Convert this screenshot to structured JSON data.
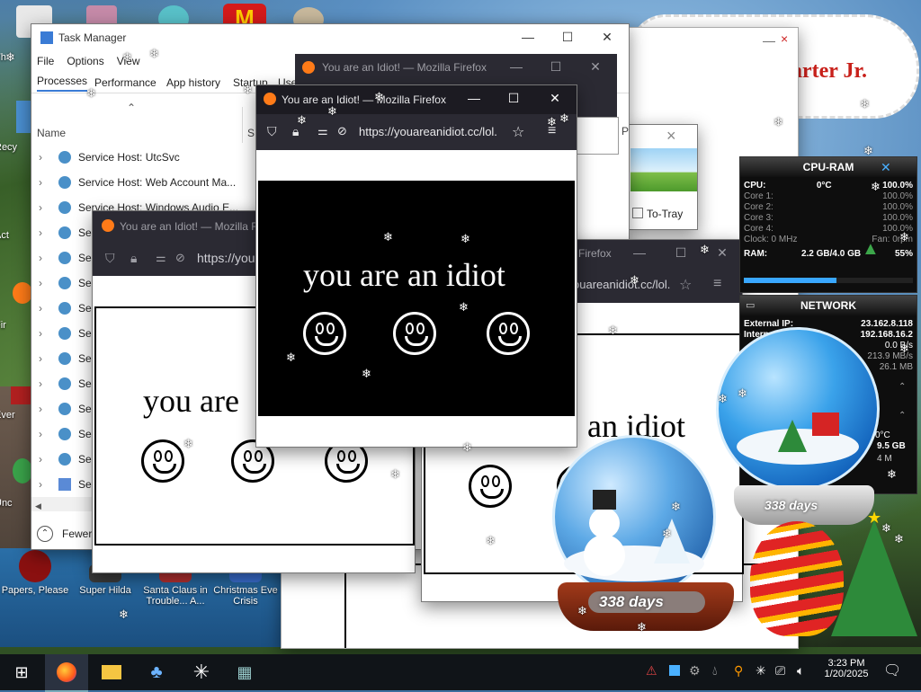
{
  "desktop": {
    "billboard_text": "arter Jr.",
    "icons": [
      {
        "label": "Papers, Please"
      },
      {
        "label": "Super Hilda"
      },
      {
        "label": "Santa Claus in Trouble... A..."
      },
      {
        "label": "Christmas Eve Crisis"
      }
    ],
    "edge_labels": [
      "Th",
      "Recy",
      "Act",
      "Fir",
      "Ever",
      "Unc"
    ]
  },
  "task_manager": {
    "title": "Task Manager",
    "menu": [
      "File",
      "Options",
      "View"
    ],
    "tabs": [
      "Processes",
      "Performance",
      "App history",
      "Startup",
      "Use"
    ],
    "col_name": "Name",
    "col_status": "S",
    "rows": [
      "Service Host: UtcSvc",
      "Service Host: Web Account Ma...",
      "Service Host: Windows Audio E...",
      "Serv",
      "Serv",
      "Serv",
      "Serv",
      "Serv",
      "Serv",
      "Serv",
      "Serv",
      "Serv",
      "Serv",
      "Serv"
    ],
    "fewer_details": "Fewer"
  },
  "windows": {
    "title": "You are an Idiot! — Mozilla Firefox",
    "url_main": "https://youareanidiot.cc/lol.",
    "url_small": "https://you",
    "url_right": "ouareanidiot.cc/lol.",
    "partial_title_right": "Firefox",
    "phrase": "you are an idiot",
    "phrase_left": "you are",
    "phrase_right": "an idiot",
    "to_tray": "To-Tray",
    "p_letter": "P"
  },
  "gadget_cpu": {
    "title": "CPU-RAM",
    "cpu_label": "CPU:",
    "cpu_temp": "0°C",
    "cpu_value": "100.0%",
    "cores": [
      {
        "label": "Core 1:",
        "value": "100.0%"
      },
      {
        "label": "Core 2:",
        "value": "100.0%"
      },
      {
        "label": "Core 3:",
        "value": "100.0%"
      },
      {
        "label": "Core 4:",
        "value": "100.0%"
      }
    ],
    "clock": "Clock: 0 MHz",
    "fan": "Fan: 0rpm",
    "ram_label": "RAM:",
    "ram_value": "2.2 GB/4.0 GB",
    "ram_pct": "55%"
  },
  "gadget_net": {
    "title": "NETWORK",
    "ext_label": "External IP:",
    "ext_value": "23.162.8.118",
    "int_label": "Intern",
    "int_value": "192.168.16.2",
    "speed": "0.0 B/s",
    "v1": "213.9 MB/s",
    "v2": "26.1 MB",
    "temp": "0°C",
    "gb": "9.5 GB",
    "m": "4 M"
  },
  "globes": {
    "left_days": "338 days",
    "right_days": "338 days"
  },
  "taskbar": {
    "time": "3:23 PM",
    "date": "1/20/2025"
  },
  "colors": {
    "firefox_dark": "#1c1b22",
    "taskbar": "#101418",
    "billboard_red": "#c8201a"
  }
}
